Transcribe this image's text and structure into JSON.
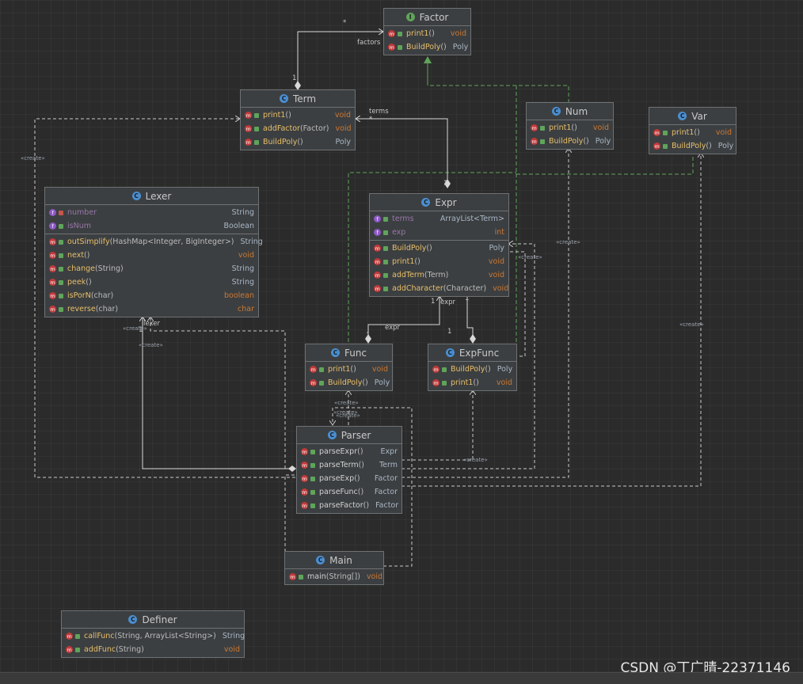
{
  "classes": {
    "factor": {
      "kind_icon": "I",
      "name": "Factor",
      "methods": [
        {
          "name": "print1",
          "params": "()",
          "ret": "void"
        },
        {
          "name": "BuildPoly",
          "params": "()",
          "ret": "Poly"
        }
      ]
    },
    "term": {
      "kind_icon": "C",
      "name": "Term",
      "methods": [
        {
          "name": "print1",
          "params": "()",
          "ret": "void"
        },
        {
          "name": "addFactor",
          "params": "(Factor)",
          "ret": "void"
        },
        {
          "name": "BuildPoly",
          "params": "()",
          "ret": "Poly"
        }
      ]
    },
    "num": {
      "kind_icon": "C",
      "name": "Num",
      "methods": [
        {
          "name": "print1",
          "params": "()",
          "ret": "void"
        },
        {
          "name": "BuildPoly",
          "params": "()",
          "ret": "Poly"
        }
      ]
    },
    "var": {
      "kind_icon": "C",
      "name": "Var",
      "methods": [
        {
          "name": "print1",
          "params": "()",
          "ret": "void"
        },
        {
          "name": "BuildPoly",
          "params": "()",
          "ret": "Poly"
        }
      ]
    },
    "lexer": {
      "kind_icon": "C",
      "name": "Lexer",
      "fields": [
        {
          "name": "number",
          "ret": "String"
        },
        {
          "name": "isNum",
          "ret": "Boolean"
        }
      ],
      "methods": [
        {
          "name": "outSimplify",
          "params": "(HashMap<Integer, BigInteger>)",
          "ret": "String"
        },
        {
          "name": "next",
          "params": "()",
          "ret": "void"
        },
        {
          "name": "change",
          "params": "(String)",
          "ret": "String"
        },
        {
          "name": "peek",
          "params": "()",
          "ret": "String"
        },
        {
          "name": "isPorN",
          "params": "(char)",
          "ret": "boolean"
        },
        {
          "name": "reverse",
          "params": "(char)",
          "ret": "char"
        }
      ]
    },
    "expr": {
      "kind_icon": "C",
      "name": "Expr",
      "fields": [
        {
          "name": "terms",
          "ret": "ArrayList<Term>"
        },
        {
          "name": "exp",
          "ret": "int"
        }
      ],
      "methods": [
        {
          "name": "BuildPoly",
          "params": "()",
          "ret": "Poly"
        },
        {
          "name": "print1",
          "params": "()",
          "ret": "void"
        },
        {
          "name": "addTerm",
          "params": "(Term)",
          "ret": "void"
        },
        {
          "name": "addCharacter",
          "params": "(Character)",
          "ret": "void"
        }
      ]
    },
    "func": {
      "kind_icon": "C",
      "name": "Func",
      "methods": [
        {
          "name": "print1",
          "params": "()",
          "ret": "void"
        },
        {
          "name": "BuildPoly",
          "params": "()",
          "ret": "Poly"
        }
      ]
    },
    "expfunc": {
      "kind_icon": "C",
      "name": "ExpFunc",
      "methods": [
        {
          "name": "BuildPoly",
          "params": "()",
          "ret": "Poly"
        },
        {
          "name": "print1",
          "params": "()",
          "ret": "void"
        }
      ]
    },
    "parser": {
      "kind_icon": "C",
      "name": "Parser",
      "methods": [
        {
          "name": "parseExpr",
          "params": "()",
          "ret": "Expr"
        },
        {
          "name": "parseTerm",
          "params": "()",
          "ret": "Term"
        },
        {
          "name": "parseExp",
          "params": "()",
          "ret": "Factor"
        },
        {
          "name": "parseFunc",
          "params": "()",
          "ret": "Factor"
        },
        {
          "name": "parseFactor",
          "params": "()",
          "ret": "Factor"
        }
      ]
    },
    "main": {
      "kind_icon": "C",
      "name": "Main",
      "methods": [
        {
          "name": "main",
          "params": "(String[])",
          "ret": "void"
        }
      ]
    },
    "definer": {
      "kind_icon": "C",
      "name": "Definer",
      "methods": [
        {
          "name": "callFunc",
          "params": "(String, ArrayList<String>)",
          "ret": "String"
        },
        {
          "name": "addFunc",
          "params": "(String)",
          "ret": "void"
        }
      ]
    }
  },
  "labels": {
    "factors": "factors",
    "factors_mult": "*",
    "term_mult": "1",
    "terms": "terms",
    "terms_mult": "*",
    "expr_mult_top": "1",
    "expr_left": "1",
    "expr_role": "expr",
    "expr_right": "1",
    "func_expr_role": "expr",
    "func_mult": "1",
    "expfunc_mult": "1",
    "lexer_role": "lexer",
    "lexer_mult": "1",
    "create": "«create»"
  },
  "watermark": "CSDN @丁广晴-22371146",
  "colors": {
    "background": "#2b2b2b",
    "class_body": "#3c3f41",
    "method_name": "#e8bf6a",
    "field_name": "#9876aa",
    "keyword_type": "#cc7832",
    "realization_line": "#5fa45a",
    "association_line": "#d8d8d8"
  }
}
